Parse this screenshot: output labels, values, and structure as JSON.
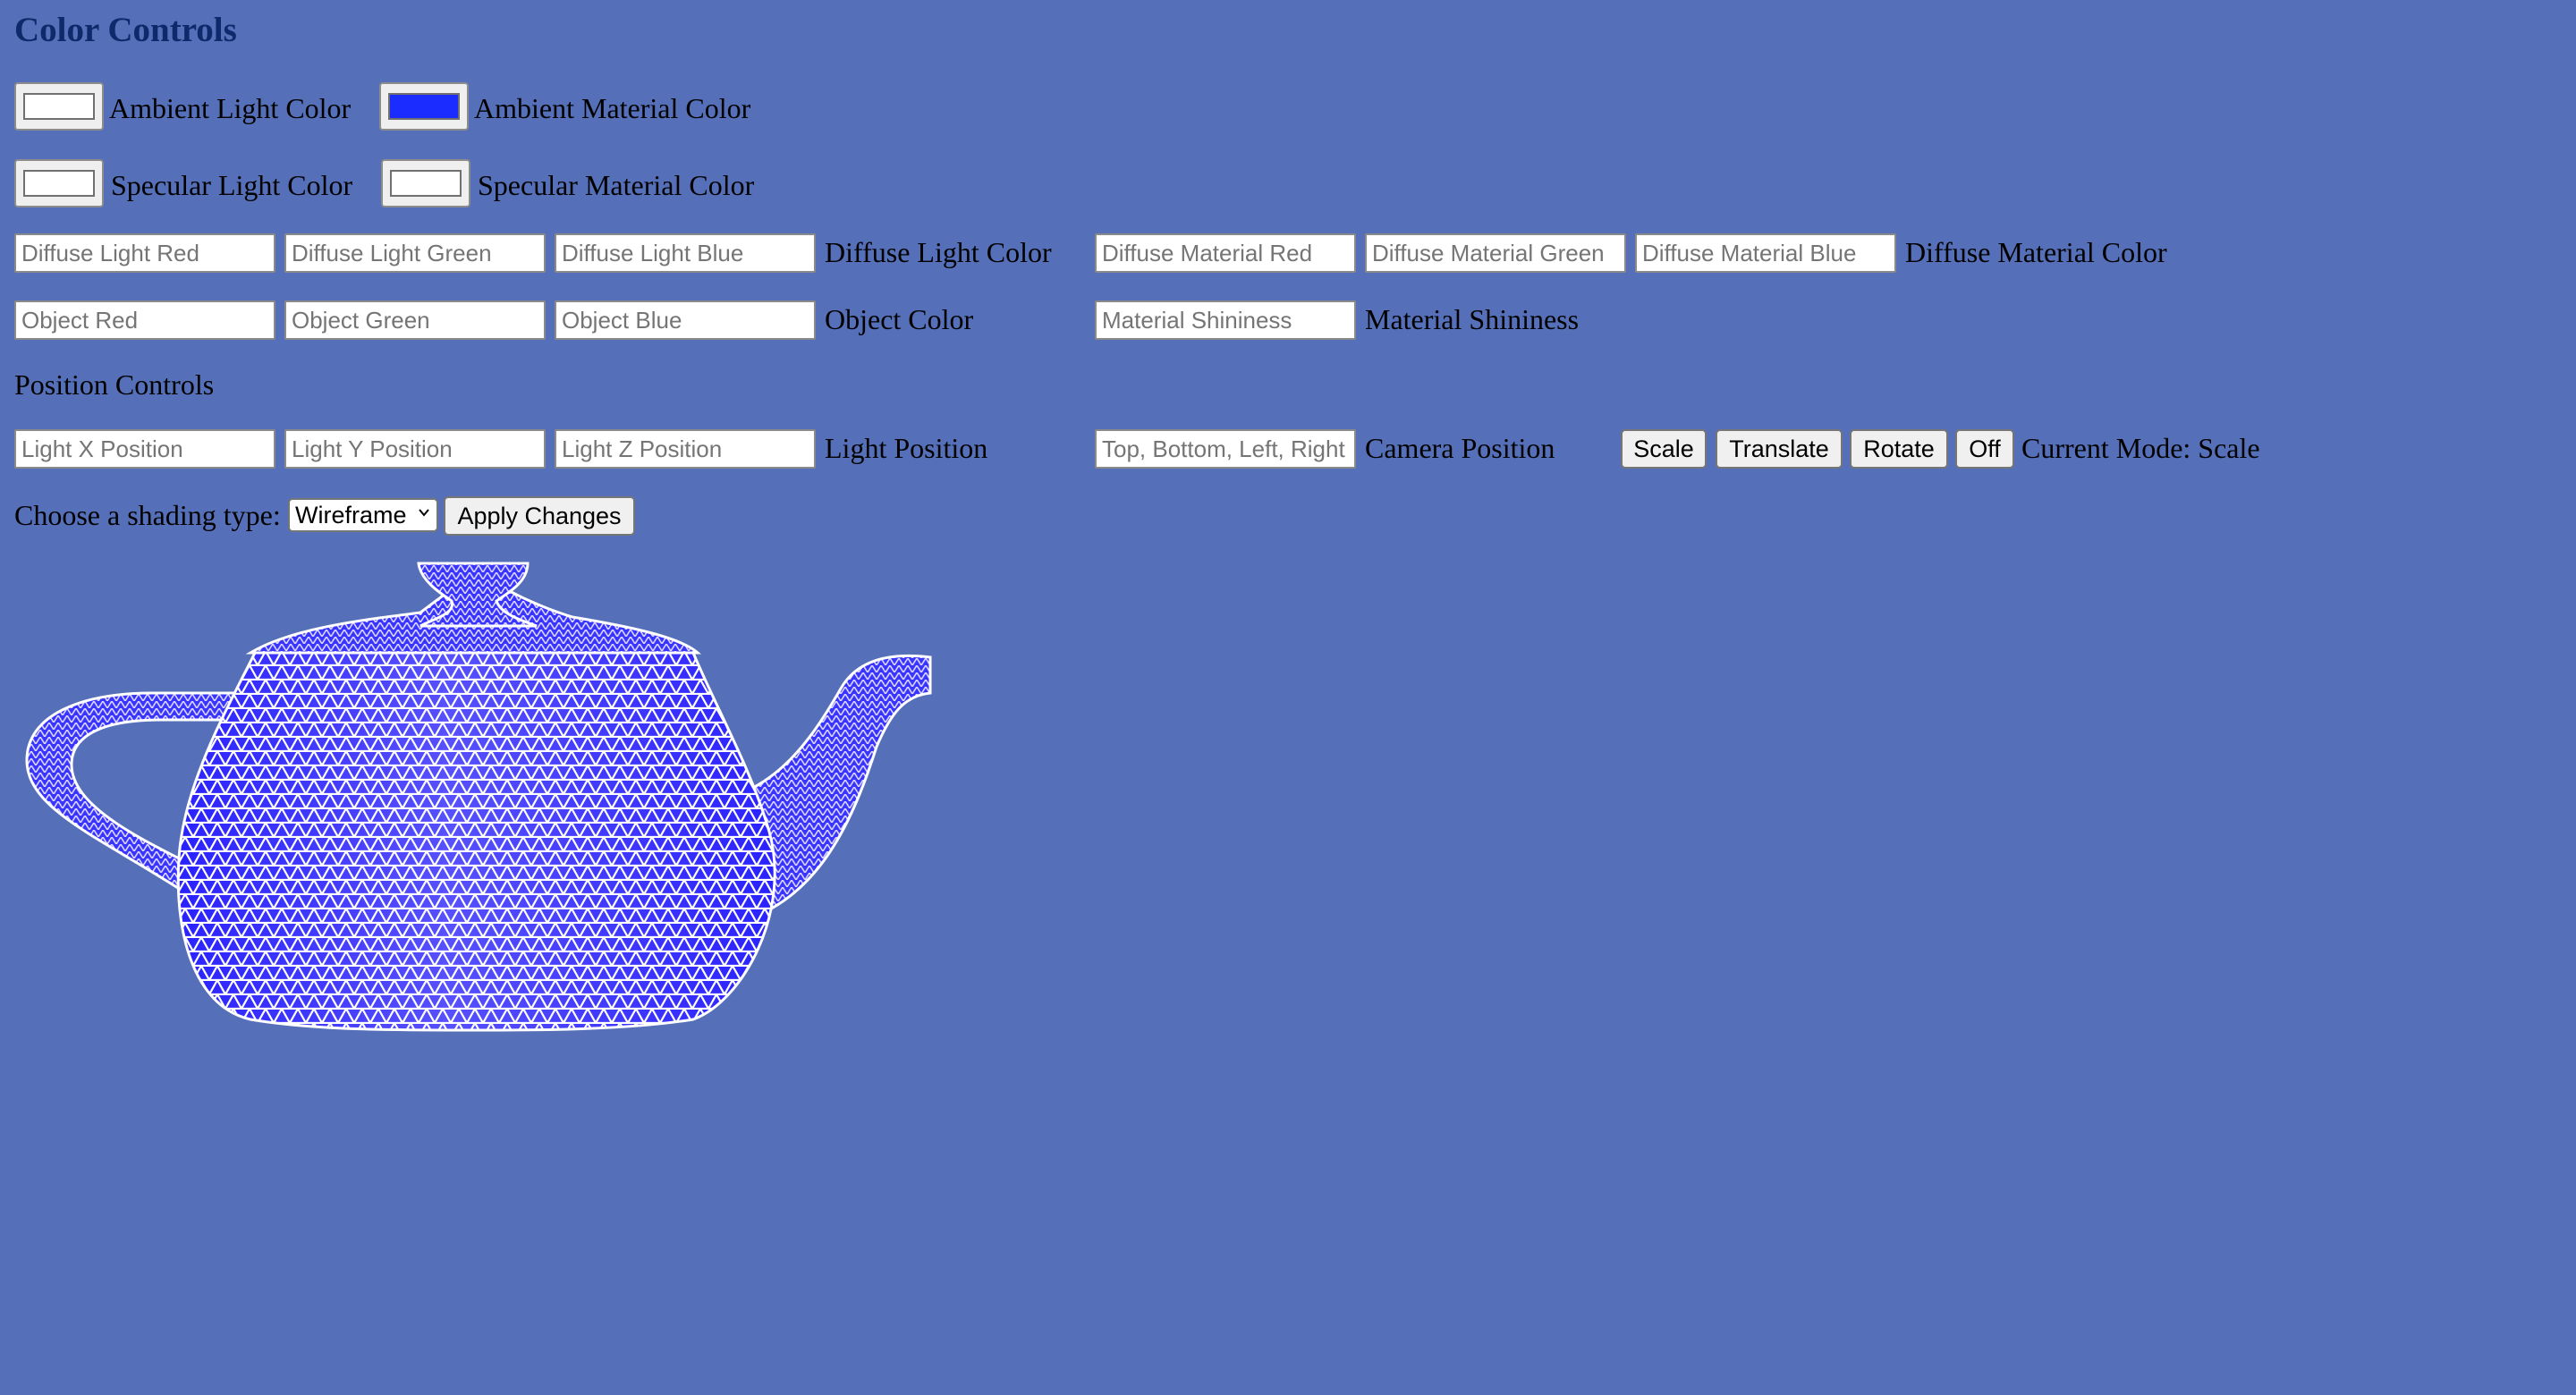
{
  "colors": {
    "background": "#5570b9",
    "heading": "#0f2a6a",
    "ambient_light_swatch": "#ffffff",
    "ambient_material_swatch": "#1a2cff",
    "specular_light_swatch": "#ffffff",
    "specular_material_swatch": "#ffffff",
    "wire_primary": "#2a22ff",
    "wire_highlight": "#ffffff"
  },
  "color_controls": {
    "heading": "Color Controls",
    "ambient_light_label": "Ambient Light Color",
    "ambient_material_label": "Ambient Material Color",
    "specular_light_label": "Specular Light Color",
    "specular_material_label": "Specular Material Color",
    "diffuse_light": {
      "red_placeholder": "Diffuse Light Red",
      "green_placeholder": "Diffuse Light Green",
      "blue_placeholder": "Diffuse Light Blue",
      "label": "Diffuse Light Color"
    },
    "diffuse_material": {
      "red_placeholder": "Diffuse Material Red",
      "green_placeholder": "Diffuse Material Green",
      "blue_placeholder": "Diffuse Material Blue",
      "label": "Diffuse Material Color"
    },
    "object": {
      "red_placeholder": "Object Red",
      "green_placeholder": "Object Green",
      "blue_placeholder": "Object Blue",
      "label": "Object Color"
    },
    "shininess": {
      "placeholder": "Material Shininess",
      "label": "Material Shininess"
    }
  },
  "position_controls": {
    "heading": "Position Controls",
    "light": {
      "x_placeholder": "Light X Position",
      "y_placeholder": "Light Y Position",
      "z_placeholder": "Light Z Position",
      "label": "Light Position"
    },
    "camera": {
      "placeholder": "Top, Bottom, Left, Right",
      "label": "Camera Position"
    },
    "mode_buttons": {
      "scale": "Scale",
      "translate": "Translate",
      "rotate": "Rotate",
      "off": "Off"
    },
    "current_mode": "Current Mode: Scale"
  },
  "shading": {
    "label": "Choose a shading type:",
    "selected": "Wireframe",
    "apply_button": "Apply Changes"
  },
  "viewport": {
    "object_icon": "teapot-wireframe"
  }
}
